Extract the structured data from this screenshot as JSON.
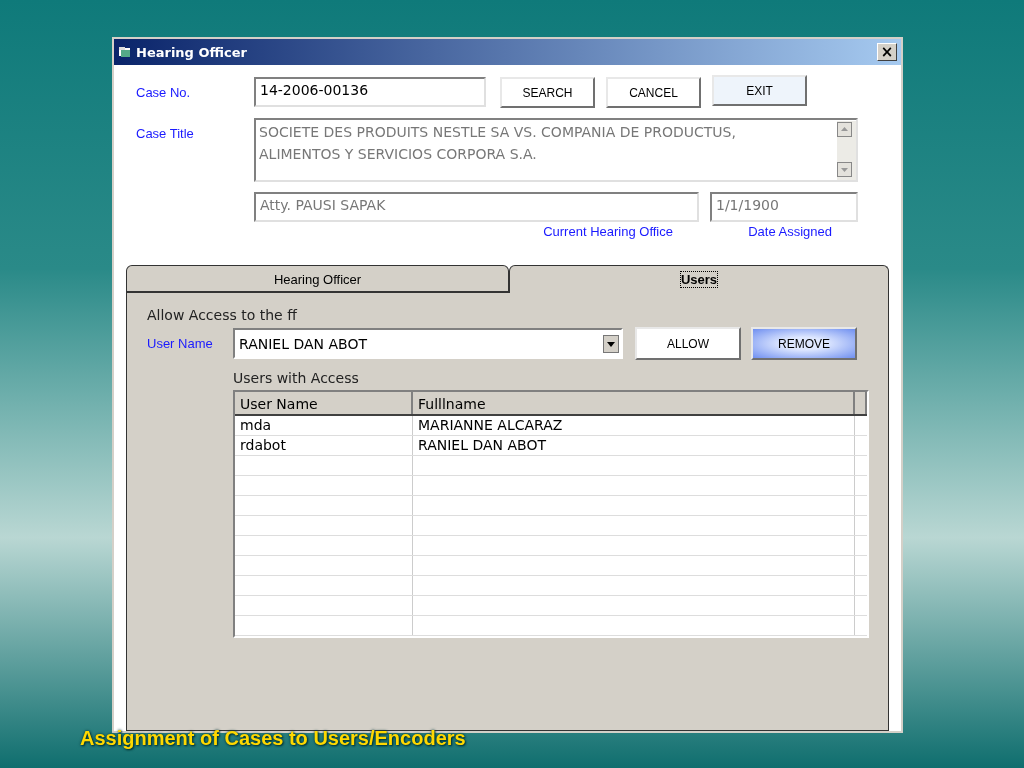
{
  "window": {
    "title": "Hearing Officer",
    "close": "×"
  },
  "form": {
    "case_no_label": "Case No.",
    "case_no": "14-2006-00136",
    "case_title_label": "Case Title",
    "case_title": "SOCIETE DES PRODUITS NESTLE SA VS. COMPANIA DE PRODUCTUS, ALIMENTOS Y SERVICIOS CORPORA S.A.",
    "hearing_officer": "Atty. PAUSI  SAPAK",
    "hearing_officer_label": "Current Hearing Office",
    "date_assigned": "1/1/1900",
    "date_assigned_label": "Date Assigned"
  },
  "buttons": [
    {
      "label": "SEARCH",
      "highlighted": false
    },
    {
      "label": "CANCEL",
      "highlighted": false
    },
    {
      "label": "EXIT",
      "highlighted": true
    }
  ],
  "tabs": [
    {
      "label": "Hearing Officer",
      "selected": false
    },
    {
      "label": "Users",
      "selected": true
    }
  ],
  "access": {
    "heading": "Allow Access to the ff",
    "user_name_label": "User Name",
    "user_name": "RANIEL DAN ABOT",
    "list_heading": "Users with Access",
    "buttons": [
      {
        "label": "ALLOW",
        "highlighted": false
      },
      {
        "label": "REMOVE",
        "highlighted": true
      }
    ]
  },
  "table": {
    "columns": [
      "User Name",
      "Fulllname"
    ],
    "rows": [
      [
        "mda",
        "MARIANNE ALCARAZ"
      ],
      [
        "rdabot",
        "RANIEL DAN ABOT"
      ]
    ]
  },
  "caption": "Assignment of Cases to Users/Encoders"
}
